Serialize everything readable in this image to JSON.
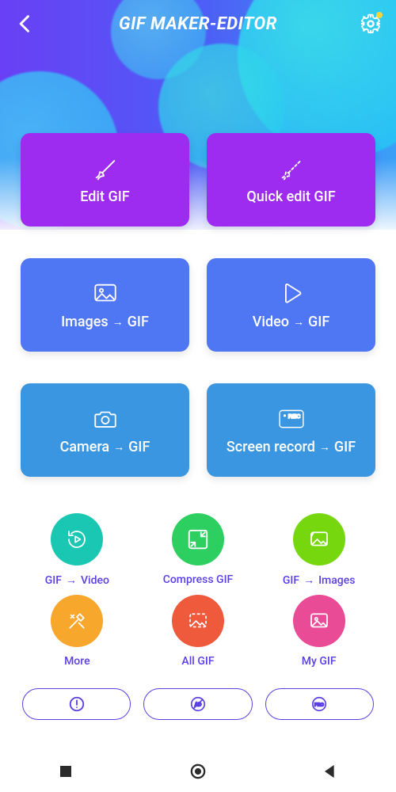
{
  "header": {
    "title": "GIF MAKER-EDITOR"
  },
  "tiles": [
    {
      "label": "Edit GIF",
      "color": "#9d2cf0",
      "icon": "brush"
    },
    {
      "label": "Quick edit GIF",
      "color": "#9d2cf0",
      "icon": "brush-dashed"
    },
    {
      "label_a": "Images",
      "label_b": "GIF",
      "color": "#4f76f3",
      "icon": "image"
    },
    {
      "label_a": "Video",
      "label_b": "GIF",
      "color": "#4f76f3",
      "icon": "play"
    },
    {
      "label_a": "Camera",
      "label_b": "GIF",
      "color": "#3a96e0",
      "icon": "camera"
    },
    {
      "label_a": "Screen record",
      "label_b": "GIF",
      "color": "#3a96e0",
      "icon": "rec"
    }
  ],
  "circles": [
    {
      "label_a": "GIF",
      "label_b": "Video",
      "color": "#19c7b2",
      "icon": "replay-play"
    },
    {
      "label": "Compress GIF",
      "color": "#2dcf60",
      "icon": "compress"
    },
    {
      "label_a": "GIF",
      "label_b": "Images",
      "color": "#76d70e",
      "icon": "gif-images"
    },
    {
      "label": "More",
      "color": "#f7a72c",
      "icon": "tools"
    },
    {
      "label": "All GIF",
      "color": "#f05a3c",
      "icon": "all-gif"
    },
    {
      "label": "My GIF",
      "color": "#ea4b97",
      "icon": "my-gif"
    }
  ],
  "pills": {
    "alert": "!",
    "ad": "AD",
    "pro": "PRO"
  }
}
